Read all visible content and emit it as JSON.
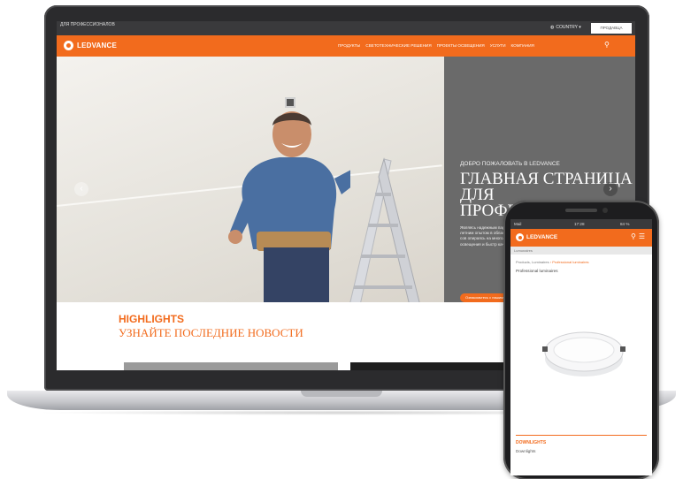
{
  "desktop": {
    "topbar": {
      "site_label": "ДЛЯ ПРОФЕССИОНАЛОВ",
      "country_label": "COUNTRY",
      "pro_button": "ПРОДАВЦА"
    },
    "brand": "LEDVANCE",
    "nav": [
      "ПРОДУКТЫ",
      "СВЕТОТЕХНИЧЕСКИЕ РЕШЕНИЯ",
      "ПРОЕКТЫ ОСВЕЩЕНИЯ",
      "УСЛУГИ",
      "КОМПАНИЯ"
    ],
    "hero": {
      "kicker": "ДОБРО ПОЖАЛОВАТЬ В LEDVANCE",
      "title": "ГЛАВНАЯ СТРАНИЦА ДЛЯ ПРОФЕССИОНАЛОВ",
      "text": "Являясь надежным партнером с более чем 100 летним опытом в области обще традиционные и сов опираясь на многол дистрибьюторную освещения и быстр качественному и в",
      "cta": "Ознакомьтесь с нашим"
    },
    "highlights": {
      "title": "HIGHLIGHTS",
      "subtitle": "УЗНАЙТЕ ПОСЛЕДНИЕ НОВОСТИ"
    }
  },
  "mobile": {
    "status": {
      "left": "Mail",
      "time": "17:28",
      "right": "84 %"
    },
    "brand": "LEDVANCE",
    "sub_bar": "Lumunaires",
    "breadcrumb": [
      "Products",
      "Luminaires",
      "Professional luminaires"
    ],
    "heading": "Professional luminaires",
    "section_title": "DOWNLIGHTS",
    "section_text": "Downlights"
  },
  "colors": {
    "accent": "#f26b1d",
    "hero_panel": "#6a6a6a"
  }
}
